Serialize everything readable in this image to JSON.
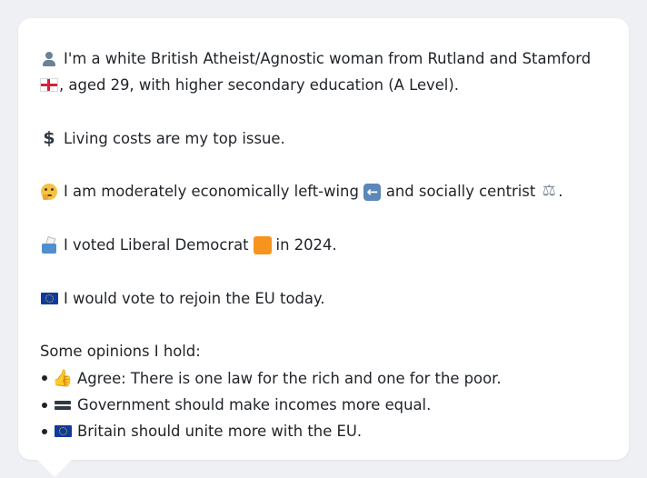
{
  "profile": {
    "intro_line1": "I'm a white British Atheist/Agnostic woman from Rutland and Stamford",
    "intro_line2": ", aged 29, with higher secondary education (A Level).",
    "top_issue": "Living costs are my top issue.",
    "ideology_part1": "I am moderately economically left-wing",
    "ideology_part2": "and socially centrist",
    "ideology_part3": ".",
    "vote_part1": "I voted Liberal Democrat",
    "vote_part2": "in 2024.",
    "eu_stance": "I would vote to rejoin the EU today.",
    "opinions_heading": "Some opinions I hold:",
    "opinions": [
      {
        "icon": "thumbs-up-icon",
        "text": "Agree: There is one law for the rich and one for the poor."
      },
      {
        "icon": "equals-icon",
        "text": "Government should make incomes more equal."
      },
      {
        "icon": "eu-flag-icon",
        "text": "Britain should unite more with the EU."
      }
    ]
  },
  "icons": {
    "person": "person-icon",
    "england_flag": "england-flag-icon",
    "dollar": "dollar-icon",
    "thinking": "thinking-face-icon",
    "left_arrow": "left-arrow-icon",
    "scales": "balance-scale-icon",
    "ballot": "ballot-box-icon",
    "party_color": "orange-square-icon",
    "eu": "eu-flag-icon"
  },
  "colors": {
    "background": "#eef0f4",
    "card": "#ffffff",
    "text": "#1f2328",
    "lib_dem_orange": "#f7941d"
  }
}
